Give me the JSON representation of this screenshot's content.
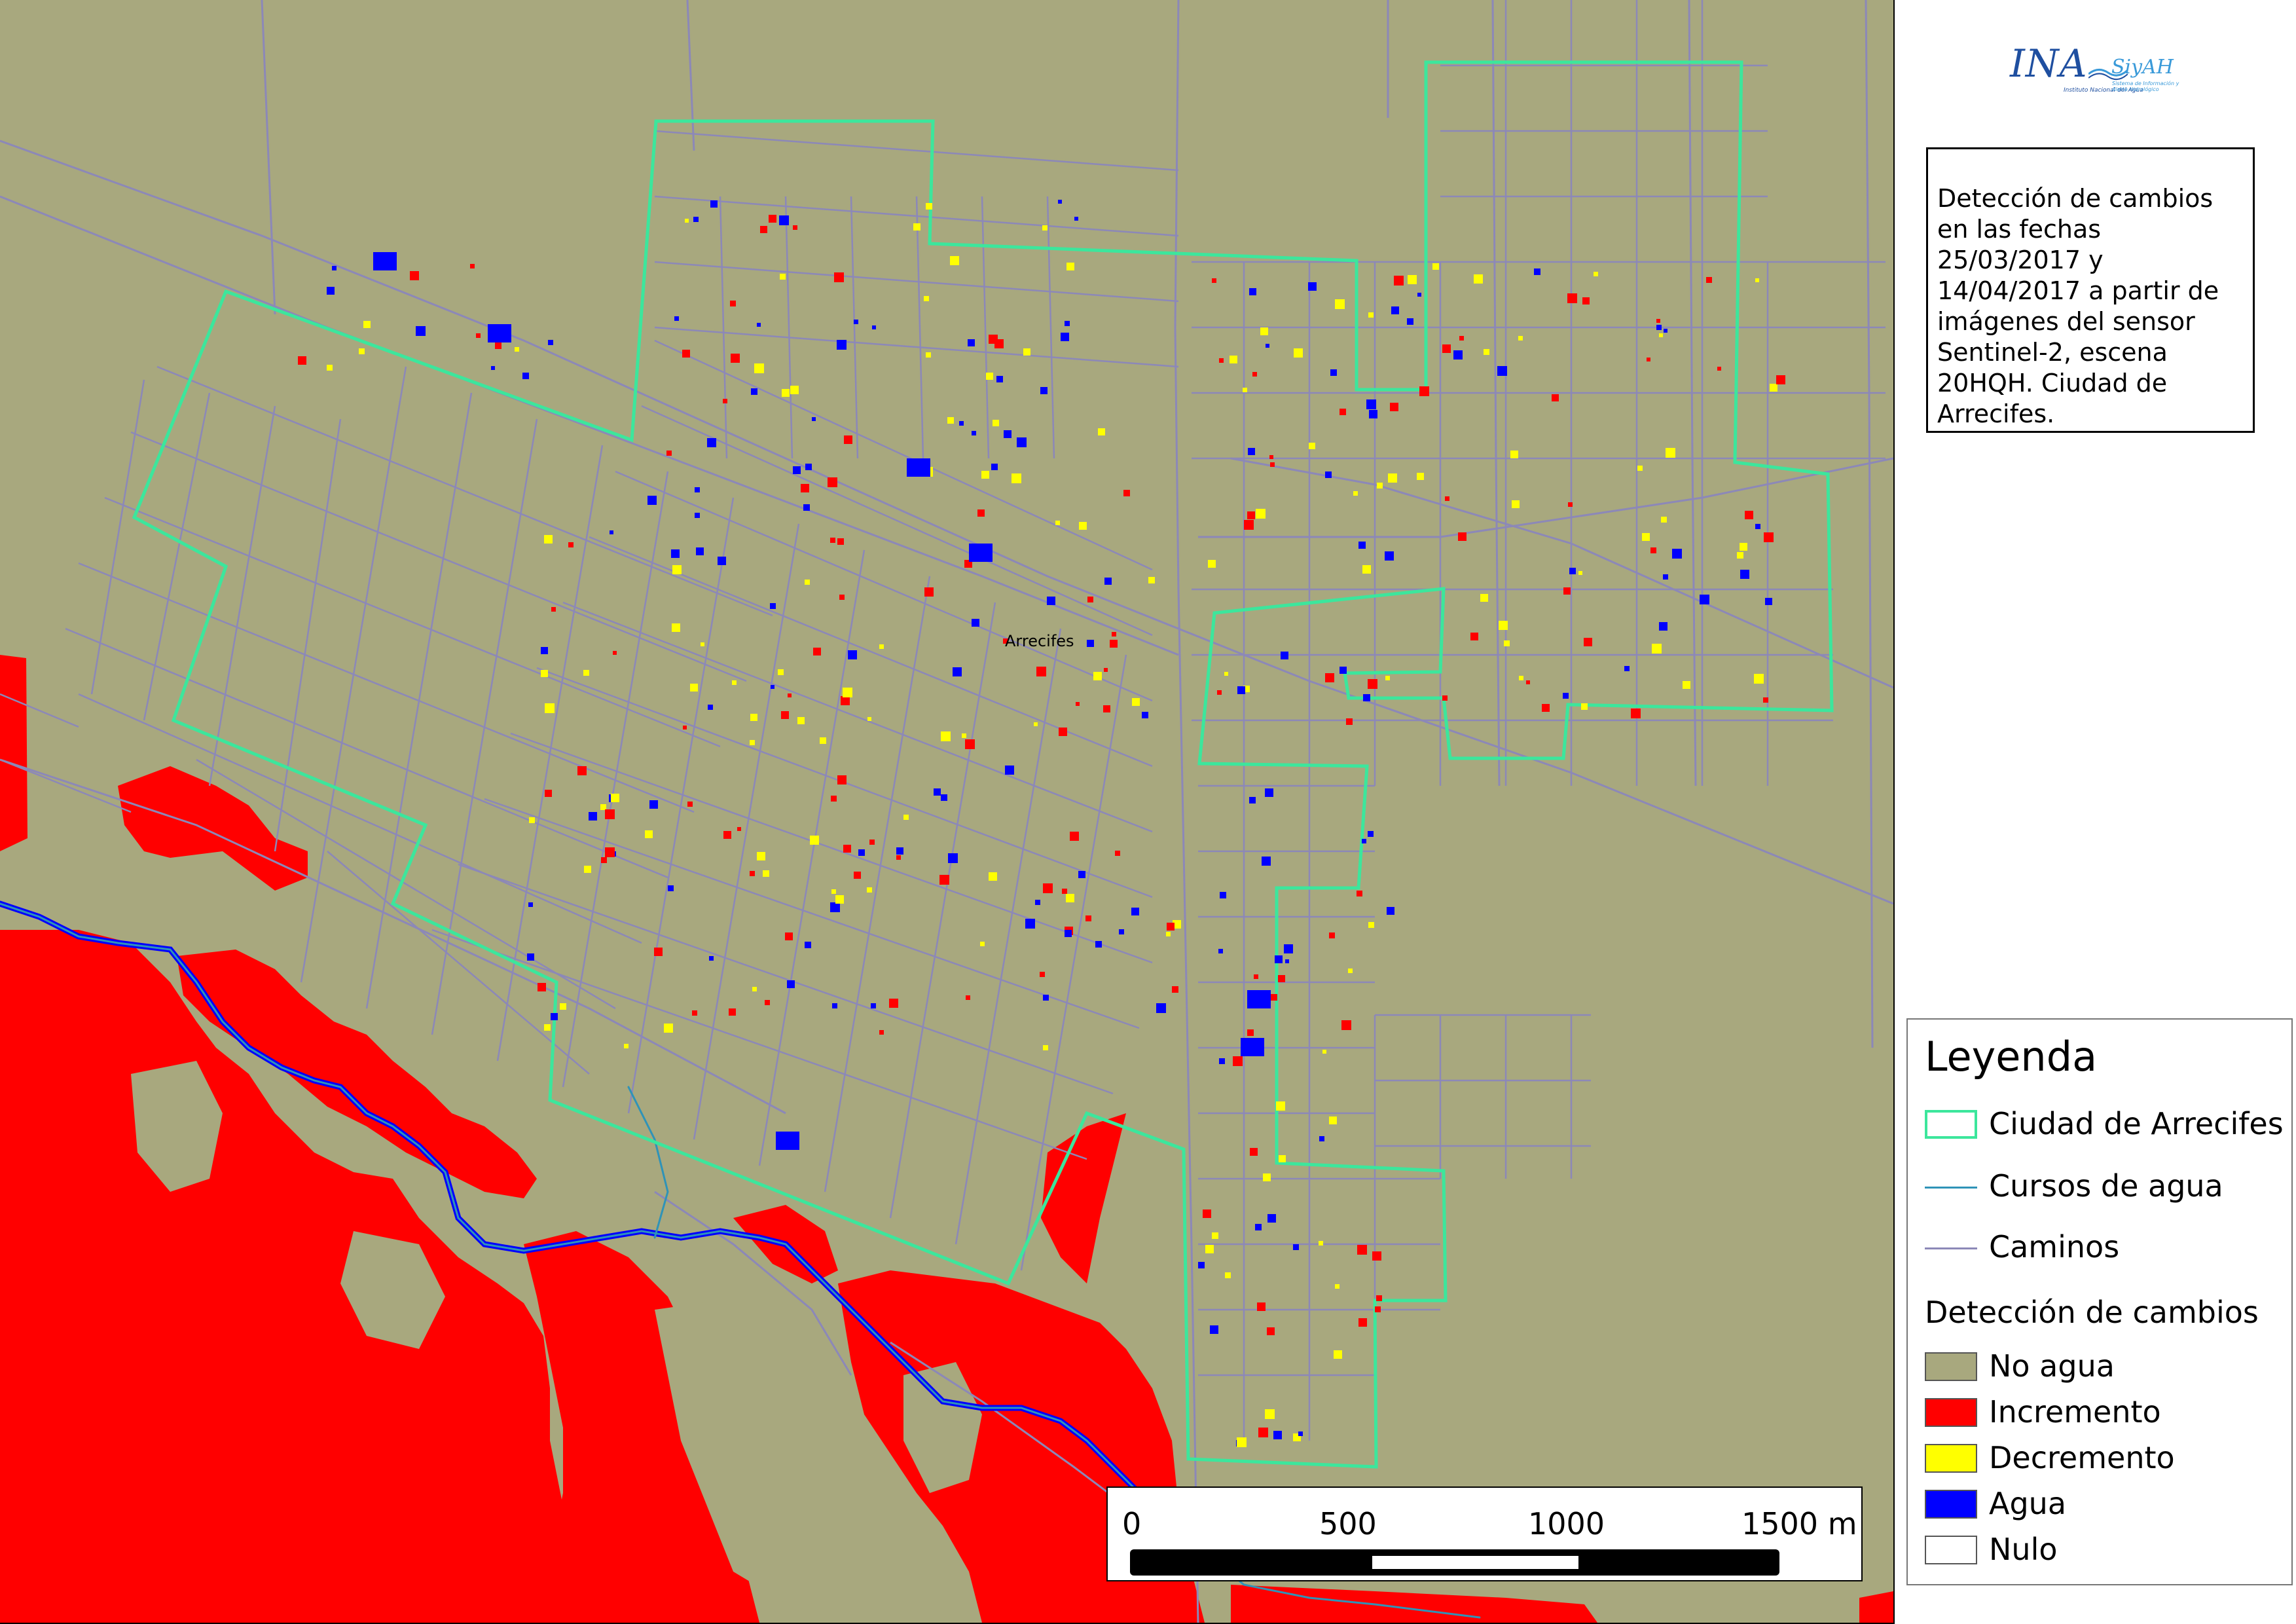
{
  "map": {
    "place_label": "Arrecifes",
    "colors": {
      "background": "#a8a87e",
      "roads": "#8c88b8",
      "boundary": "#3ce69c",
      "river": "#2f93b8",
      "increment": "#ff0000",
      "decrement": "#ffff00",
      "water": "#0000ff"
    }
  },
  "logo": {
    "primary": "INA",
    "secondary": "SiyAH",
    "subtitle_left": "Instituto Nacional del Agua",
    "subtitle_right": "Sistema de Información y Alerta Hidrológico"
  },
  "description": "Detección de cambios en las fechas 25/03/2017 y 14/04/2017 a partir de imágenes del sensor Sentinel-2, escena 20HQH. Ciudad de Arrecifes.",
  "legend": {
    "title": "Leyenda",
    "lines": [
      {
        "label": "Ciudad de Arrecifes",
        "symbol": "boundary",
        "color": "#3ce69c"
      },
      {
        "label": "Cursos de agua",
        "symbol": "line",
        "color": "#2f93b8"
      },
      {
        "label": "Caminos",
        "symbol": "line",
        "color": "#8c88b8"
      }
    ],
    "classes_title": "Detección de cambios",
    "classes": [
      {
        "label": "No agua",
        "color": "#a8a87e"
      },
      {
        "label": "Incremento",
        "color": "#ff0000"
      },
      {
        "label": "Decremento",
        "color": "#ffff00"
      },
      {
        "label": "Agua",
        "color": "#0000ff"
      },
      {
        "label": "Nulo",
        "color": "#ffffff"
      }
    ]
  },
  "scale": {
    "labels": [
      "0",
      "500",
      "1000",
      "1500 m"
    ]
  }
}
